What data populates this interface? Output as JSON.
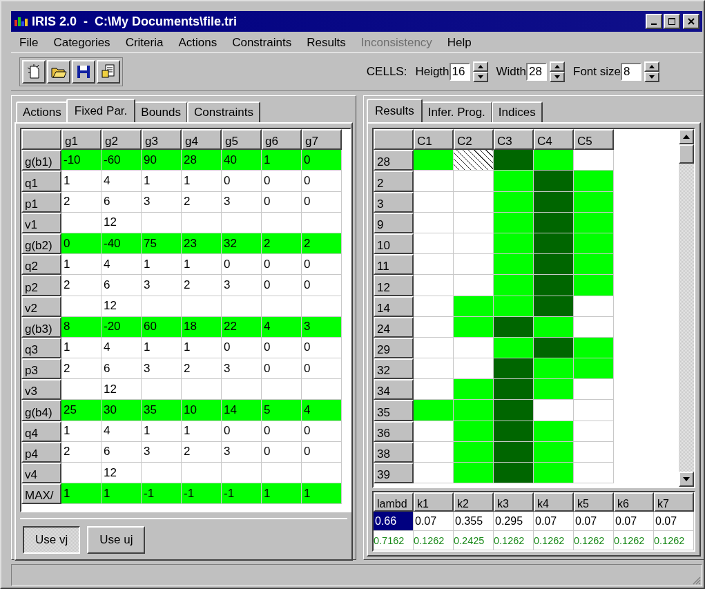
{
  "window": {
    "title": "IRIS 2.0  -  C:\\My Documents\\file.tri"
  },
  "menu": [
    {
      "label": "File",
      "disabled": false
    },
    {
      "label": "Categories",
      "disabled": false
    },
    {
      "label": "Criteria",
      "disabled": false
    },
    {
      "label": "Actions",
      "disabled": false
    },
    {
      "label": "Constraints",
      "disabled": false
    },
    {
      "label": "Results",
      "disabled": false
    },
    {
      "label": "Inconsistency",
      "disabled": true
    },
    {
      "label": "Help",
      "disabled": false
    }
  ],
  "toolbar": {
    "cells_label": "CELLS:",
    "fields": [
      {
        "label": "Heigth",
        "value": "16"
      },
      {
        "label": "Width",
        "value": "28"
      },
      {
        "label": "Font size",
        "value": "8"
      }
    ]
  },
  "left_panel": {
    "tabs": [
      {
        "label": "Actions",
        "selected": false
      },
      {
        "label": "Fixed Par.",
        "selected": true
      },
      {
        "label": "Bounds",
        "selected": false
      },
      {
        "label": "Constraints",
        "selected": false
      }
    ],
    "columns": [
      "g1",
      "g2",
      "g3",
      "g4",
      "g5",
      "g6",
      "g7"
    ],
    "rows": [
      {
        "label": "g(b1)",
        "highlighted": true,
        "cells": [
          "-10",
          "-60",
          "90",
          "28",
          "40",
          "1",
          "0"
        ]
      },
      {
        "label": "q1",
        "highlighted": false,
        "cells": [
          "1",
          "4",
          "1",
          "1",
          "0",
          "0",
          "0"
        ]
      },
      {
        "label": "p1",
        "highlighted": false,
        "cells": [
          "2",
          "6",
          "3",
          "2",
          "3",
          "0",
          "0"
        ]
      },
      {
        "label": "v1",
        "highlighted": false,
        "cells": [
          "",
          "12",
          "",
          "",
          "",
          "",
          ""
        ]
      },
      {
        "label": "g(b2)",
        "highlighted": true,
        "cells": [
          "0",
          "-40",
          "75",
          "23",
          "32",
          "2",
          "2"
        ]
      },
      {
        "label": "q2",
        "highlighted": false,
        "cells": [
          "1",
          "4",
          "1",
          "1",
          "0",
          "0",
          "0"
        ]
      },
      {
        "label": "p2",
        "highlighted": false,
        "cells": [
          "2",
          "6",
          "3",
          "2",
          "3",
          "0",
          "0"
        ]
      },
      {
        "label": "v2",
        "highlighted": false,
        "cells": [
          "",
          "12",
          "",
          "",
          "",
          "",
          ""
        ]
      },
      {
        "label": "g(b3)",
        "highlighted": true,
        "cells": [
          "8",
          "-20",
          "60",
          "18",
          "22",
          "4",
          "3"
        ]
      },
      {
        "label": "q3",
        "highlighted": false,
        "cells": [
          "1",
          "4",
          "1",
          "1",
          "0",
          "0",
          "0"
        ]
      },
      {
        "label": "p3",
        "highlighted": false,
        "cells": [
          "2",
          "6",
          "3",
          "2",
          "3",
          "0",
          "0"
        ]
      },
      {
        "label": "v3",
        "highlighted": false,
        "cells": [
          "",
          "12",
          "",
          "",
          "",
          "",
          ""
        ]
      },
      {
        "label": "g(b4)",
        "highlighted": true,
        "cells": [
          "25",
          "30",
          "35",
          "10",
          "14",
          "5",
          "4"
        ]
      },
      {
        "label": "q4",
        "highlighted": false,
        "cells": [
          "1",
          "4",
          "1",
          "1",
          "0",
          "0",
          "0"
        ]
      },
      {
        "label": "p4",
        "highlighted": false,
        "cells": [
          "2",
          "6",
          "3",
          "2",
          "3",
          "0",
          "0"
        ]
      },
      {
        "label": "v4",
        "highlighted": false,
        "cells": [
          "",
          "12",
          "",
          "",
          "",
          "",
          ""
        ]
      },
      {
        "label": "MAX/",
        "highlighted": true,
        "cells": [
          "1",
          "1",
          "-1",
          "-1",
          "-1",
          "1",
          "1"
        ]
      }
    ],
    "buttons": [
      {
        "label": "Use vj",
        "pressed": true
      },
      {
        "label": "Use uj",
        "pressed": false
      }
    ]
  },
  "right_panel": {
    "tabs": [
      {
        "label": "Results",
        "selected": true
      },
      {
        "label": "Infer. Prog.",
        "selected": false
      },
      {
        "label": "Indices",
        "selected": false
      }
    ],
    "columns": [
      "C1",
      "C2",
      "C3",
      "C4",
      "C5"
    ],
    "rows": [
      {
        "label": "28",
        "cells": [
          {
            "kind": "light"
          },
          {
            "kind": "hatched"
          },
          {
            "kind": "dark"
          },
          {
            "kind": "light"
          },
          {
            "kind": "empty"
          }
        ]
      },
      {
        "label": "2",
        "cells": [
          {
            "kind": "empty"
          },
          {
            "kind": "empty"
          },
          {
            "kind": "light"
          },
          {
            "kind": "dark"
          },
          {
            "kind": "light"
          }
        ]
      },
      {
        "label": "3",
        "cells": [
          {
            "kind": "empty"
          },
          {
            "kind": "empty"
          },
          {
            "kind": "light"
          },
          {
            "kind": "dark"
          },
          {
            "kind": "light"
          }
        ]
      },
      {
        "label": "9",
        "cells": [
          {
            "kind": "empty"
          },
          {
            "kind": "empty"
          },
          {
            "kind": "light"
          },
          {
            "kind": "dark"
          },
          {
            "kind": "light"
          }
        ]
      },
      {
        "label": "10",
        "cells": [
          {
            "kind": "empty"
          },
          {
            "kind": "empty"
          },
          {
            "kind": "light"
          },
          {
            "kind": "dark"
          },
          {
            "kind": "light"
          }
        ]
      },
      {
        "label": "11",
        "cells": [
          {
            "kind": "empty"
          },
          {
            "kind": "empty"
          },
          {
            "kind": "light"
          },
          {
            "kind": "dark"
          },
          {
            "kind": "light"
          }
        ]
      },
      {
        "label": "12",
        "cells": [
          {
            "kind": "empty"
          },
          {
            "kind": "empty"
          },
          {
            "kind": "light"
          },
          {
            "kind": "dark"
          },
          {
            "kind": "light"
          }
        ]
      },
      {
        "label": "14",
        "cells": [
          {
            "kind": "empty"
          },
          {
            "kind": "light"
          },
          {
            "kind": "light"
          },
          {
            "kind": "dark"
          },
          {
            "kind": "empty"
          }
        ]
      },
      {
        "label": "24",
        "cells": [
          {
            "kind": "empty"
          },
          {
            "kind": "light"
          },
          {
            "kind": "dark"
          },
          {
            "kind": "light"
          },
          {
            "kind": "empty"
          }
        ]
      },
      {
        "label": "29",
        "cells": [
          {
            "kind": "empty"
          },
          {
            "kind": "empty"
          },
          {
            "kind": "light"
          },
          {
            "kind": "dark"
          },
          {
            "kind": "light"
          }
        ]
      },
      {
        "label": "32",
        "cells": [
          {
            "kind": "empty"
          },
          {
            "kind": "empty"
          },
          {
            "kind": "dark"
          },
          {
            "kind": "light"
          },
          {
            "kind": "light"
          }
        ]
      },
      {
        "label": "34",
        "cells": [
          {
            "kind": "empty"
          },
          {
            "kind": "light"
          },
          {
            "kind": "dark"
          },
          {
            "kind": "light"
          },
          {
            "kind": "empty"
          }
        ]
      },
      {
        "label": "35",
        "cells": [
          {
            "kind": "light"
          },
          {
            "kind": "light"
          },
          {
            "kind": "dark"
          },
          {
            "kind": "empty"
          },
          {
            "kind": "empty"
          }
        ]
      },
      {
        "label": "36",
        "cells": [
          {
            "kind": "empty"
          },
          {
            "kind": "light"
          },
          {
            "kind": "dark"
          },
          {
            "kind": "light"
          },
          {
            "kind": "empty"
          }
        ]
      },
      {
        "label": "38",
        "cells": [
          {
            "kind": "empty"
          },
          {
            "kind": "light"
          },
          {
            "kind": "dark"
          },
          {
            "kind": "light"
          },
          {
            "kind": "empty"
          }
        ]
      },
      {
        "label": "39",
        "cells": [
          {
            "kind": "empty"
          },
          {
            "kind": "light"
          },
          {
            "kind": "dark"
          },
          {
            "kind": "light"
          },
          {
            "kind": "empty"
          }
        ]
      }
    ],
    "weights": {
      "columns": [
        "lambd",
        "k1",
        "k2",
        "k3",
        "k4",
        "k5",
        "k6",
        "k7"
      ],
      "values": [
        {
          "text": "0.66",
          "selected": true
        },
        {
          "text": "0.07",
          "selected": false
        },
        {
          "text": "0.355",
          "selected": false
        },
        {
          "text": "0.295",
          "selected": false
        },
        {
          "text": "0.07",
          "selected": false
        },
        {
          "text": "0.07",
          "selected": false
        },
        {
          "text": "0.07",
          "selected": false
        },
        {
          "text": "0.07",
          "selected": false
        }
      ],
      "inferred": [
        "0.7162",
        "0.1262",
        "0.2425",
        "0.1262",
        "0.1262",
        "0.1262",
        "0.1262",
        "0.1262"
      ]
    }
  }
}
